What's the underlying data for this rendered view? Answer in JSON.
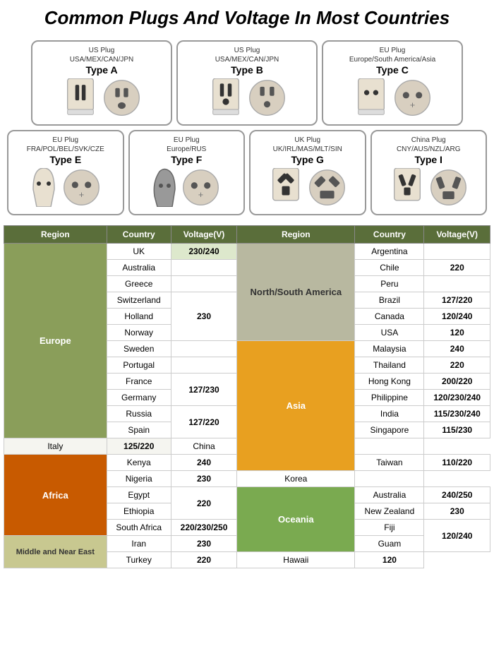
{
  "title": "Common Plugs And Voltage In Most Countries",
  "plugs": {
    "row1": [
      {
        "label": "US Plug",
        "sublabel": "USA/MEX/CAN/JPN",
        "type": "Type A",
        "shape": "typeA"
      },
      {
        "label": "US Plug",
        "sublabel": "USA/MEX/CAN/JPN",
        "type": "Type B",
        "shape": "typeB"
      },
      {
        "label": "EU Plug",
        "sublabel": "Europe/South America/Asia",
        "type": "Type C",
        "shape": "typeC"
      }
    ],
    "row2": [
      {
        "label": "EU Plug",
        "sublabel": "FRA/POL/BEL/SVK/CZE",
        "type": "Type E",
        "shape": "typeE"
      },
      {
        "label": "EU Plug",
        "sublabel": "Europe/RUS",
        "type": "Type F",
        "shape": "typeF"
      },
      {
        "label": "UK Plug",
        "sublabel": "UK/IRL/MAS/MLT/SIN",
        "type": "Type G",
        "shape": "typeG"
      },
      {
        "label": "China Plug",
        "sublabel": "CNY/AUS/NZL/ARG",
        "type": "Type I",
        "shape": "typeI"
      }
    ]
  },
  "table": {
    "headers": [
      "Region",
      "Country",
      "Voltage(V)",
      "Region",
      "Country",
      "Voltage(V)"
    ],
    "rows": [
      {
        "region": "Europe",
        "regionSpan": 12,
        "regionClass": "region-europe",
        "leftCountry": "UK",
        "leftVoltage": "230/240",
        "leftVoltageClass": "uk-230",
        "rightRegion": "North/South America",
        "rightRegionSpan": 6,
        "rightRegionClass": "region-north-south",
        "rightCountry": "Argentina",
        "rightVoltage": ""
      },
      {
        "leftCountry": "Australia",
        "leftVoltage": "",
        "rightCountry": "Chile",
        "rightVoltage": "220"
      },
      {
        "leftCountry": "Greece",
        "leftVoltage": "",
        "rightCountry": "Peru",
        "rightVoltage": ""
      },
      {
        "leftCountry": "Switzerland",
        "leftVoltage": "230",
        "rightCountry": "Brazil",
        "rightVoltage": "127/220"
      },
      {
        "leftCountry": "Holland",
        "leftVoltage": "",
        "rightCountry": "Canada",
        "rightVoltage": "120/240"
      },
      {
        "leftCountry": "Norway",
        "leftVoltage": "",
        "rightCountry": "USA",
        "rightVoltage": "120"
      },
      {
        "leftCountry": "Sweden",
        "leftVoltage": "",
        "rightRegion": "Asia",
        "rightRegionSpan": 8,
        "rightRegionClass": "region-asia",
        "rightCountry": "Malaysia",
        "rightVoltage": "240"
      },
      {
        "leftCountry": "Portugal",
        "leftVoltage": "",
        "rightCountry": "Thailand",
        "rightVoltage": "220"
      },
      {
        "leftCountry": "France",
        "leftVoltage": "127/230",
        "rightCountry": "Hong Kong",
        "rightVoltage": "200/220"
      },
      {
        "leftCountry": "Germany",
        "leftVoltage": "",
        "rightCountry": "Philippine",
        "rightVoltage": "120/230/240"
      },
      {
        "leftCountry": "Russia",
        "leftVoltage": "127/220",
        "rightCountry": "India",
        "rightVoltage": "115/230/240"
      },
      {
        "leftCountry": "Spain",
        "leftVoltage": "",
        "rightCountry": "Singapore",
        "rightVoltage": "115/230"
      },
      {
        "leftCountry": "Italy",
        "leftVoltage": "125/220",
        "rightCountry": "China",
        "rightVoltage": ""
      },
      {
        "region": "Africa",
        "regionSpan": 5,
        "regionClass": "region-africa",
        "leftCountry": "Kenya",
        "leftVoltage": "240",
        "rightCountry": "Taiwan",
        "rightVoltage": "110/220"
      },
      {
        "leftCountry": "Nigeria",
        "leftVoltage": "230",
        "rightCountry": "Korea",
        "rightVoltage": ""
      },
      {
        "leftCountry": "Egypt",
        "leftVoltage": "",
        "rightRegion": "Oceania",
        "rightRegionSpan": 4,
        "rightRegionClass": "region-oceania",
        "rightCountry": "Australia",
        "rightVoltage": "240/250"
      },
      {
        "leftCountry": "Ethiopia",
        "leftVoltage": "220",
        "rightCountry": "New Zealand",
        "rightVoltage": "230"
      },
      {
        "leftCountry": "South Africa",
        "leftVoltage": "220/230/250",
        "rightCountry": "Fiji",
        "rightVoltage": ""
      },
      {
        "region": "Middle and Near East",
        "regionSpan": 2,
        "regionClass": "region-middle",
        "leftCountry": "Iran",
        "leftVoltage": "230",
        "rightCountry": "Guam",
        "rightVoltage": "120/240"
      },
      {
        "leftCountry": "Turkey",
        "leftVoltage": "220",
        "rightCountry": "Hawaii",
        "rightVoltage": "120"
      }
    ]
  }
}
